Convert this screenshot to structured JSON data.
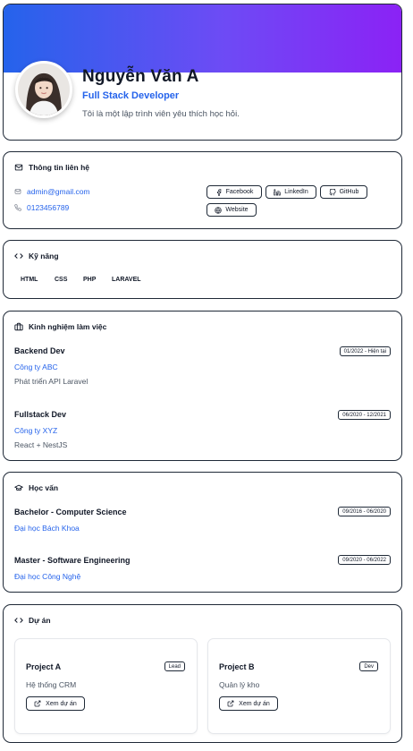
{
  "profile": {
    "name": "Nguyễn Văn A",
    "role": "Full Stack Developer",
    "bio": "Tôi là một lập trình viên yêu thích học hỏi."
  },
  "contact": {
    "title": "Thông tin liên hệ",
    "email": "admin@gmail.com",
    "phone": "0123456789",
    "socials": [
      "Facebook",
      "LinkedIn",
      "GitHub",
      "Website"
    ]
  },
  "skills": {
    "title": "Kỹ năng",
    "items": [
      "HTML",
      "CSS",
      "PHP",
      "LARAVEL"
    ]
  },
  "experience": {
    "title": "Kinh nghiệm làm việc",
    "items": [
      {
        "position": "Backend Dev",
        "company": "Công ty ABC",
        "description": "Phát triển API Laravel",
        "period": "01/2022 - Hiện tại"
      },
      {
        "position": "Fullstack Dev",
        "company": "Công ty XYZ",
        "description": "React + NestJS",
        "period": "06/2020 - 12/2021"
      }
    ]
  },
  "education": {
    "title": "Học vấn",
    "items": [
      {
        "degree": "Bachelor - Computer Science",
        "school": "Đại học Bách Khoa",
        "period": "09/2016 - 06/2020"
      },
      {
        "degree": "Master - Software Engineering",
        "school": "Đại học Công Nghệ",
        "period": "09/2020 - 06/2022"
      }
    ]
  },
  "projects": {
    "title": "Dự án",
    "items": [
      {
        "name": "Project A",
        "description": "Hệ thống CRM",
        "role": "Lead",
        "action": "Xem dự án"
      },
      {
        "name": "Project B",
        "description": "Quản lý kho",
        "role": "Dev",
        "action": "Xem dự án"
      }
    ]
  },
  "colors": {
    "accent": "#2563eb",
    "banner_start": "#2563eb",
    "banner_end": "#8b22f5"
  },
  "icons": [
    "mail-icon",
    "phone-icon",
    "facebook-icon",
    "linkedin-icon",
    "github-icon",
    "globe-icon",
    "code-icon",
    "briefcase-icon",
    "graduation-cap-icon",
    "external-link-icon"
  ]
}
